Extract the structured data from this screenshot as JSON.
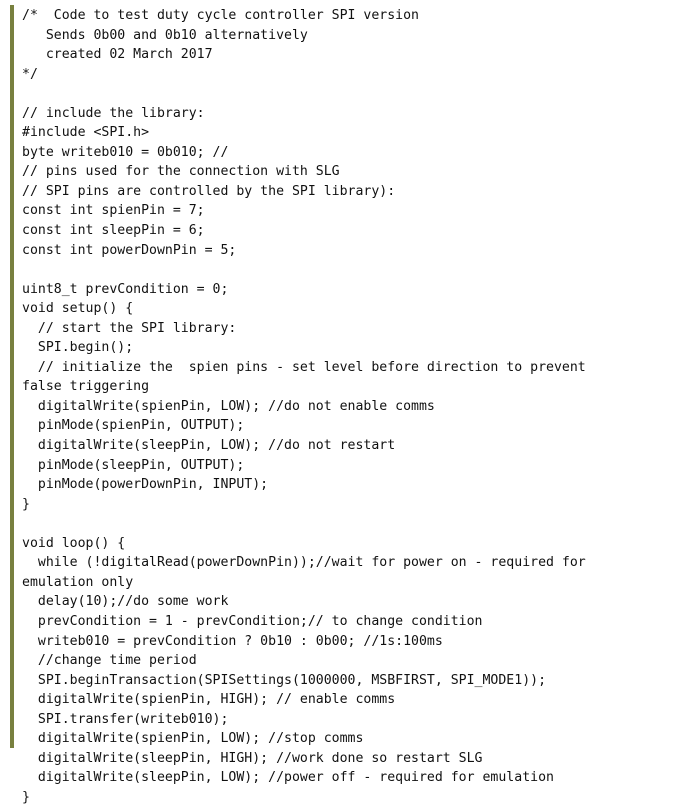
{
  "document": {
    "kind": "source-code-listing",
    "language": "arduino-c",
    "accent_color": "#78803f",
    "background_color": "#ffffff",
    "text_color": "#111111",
    "lines": [
      "/*  Code to test duty cycle controller SPI version",
      "   Sends 0b00 and 0b10 alternatively",
      "   created 02 March 2017",
      "*/",
      "",
      "// include the library:",
      "#include <SPI.h>",
      "byte writeb010 = 0b010; //",
      "// pins used for the connection with SLG",
      "// SPI pins are controlled by the SPI library):",
      "const int spienPin = 7;",
      "const int sleepPin = 6;",
      "const int powerDownPin = 5;",
      "",
      "uint8_t prevCondition = 0;",
      "void setup() {",
      "  // start the SPI library:",
      "  SPI.begin();",
      "  // initialize the  spien pins - set level before direction to prevent",
      "false triggering",
      "  digitalWrite(spienPin, LOW); //do not enable comms",
      "  pinMode(spienPin, OUTPUT);",
      "  digitalWrite(sleepPin, LOW); //do not restart",
      "  pinMode(sleepPin, OUTPUT);",
      "  pinMode(powerDownPin, INPUT);",
      "}",
      "",
      "void loop() {",
      "  while (!digitalRead(powerDownPin));//wait for power on - required for",
      "emulation only",
      "  delay(10);//do some work",
      "  prevCondition = 1 - prevCondition;// to change condition",
      "  writeb010 = prevCondition ? 0b10 : 0b00; //1s:100ms",
      "  //change time period",
      "  SPI.beginTransaction(SPISettings(1000000, MSBFIRST, SPI_MODE1));",
      "  digitalWrite(spienPin, HIGH); // enable comms",
      "  SPI.transfer(writeb010);",
      "  digitalWrite(spienPin, LOW); //stop comms",
      "  digitalWrite(sleepPin, HIGH); //work done so restart SLG",
      "  digitalWrite(sleepPin, LOW); //power off - required for emulation",
      "}"
    ]
  }
}
